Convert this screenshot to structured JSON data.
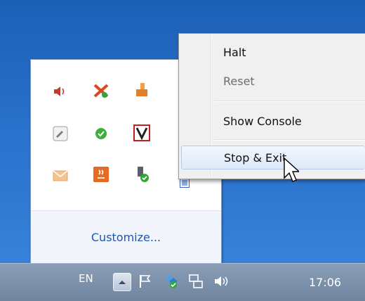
{
  "desktop": {
    "background": "#2a72cc"
  },
  "flyout": {
    "icons": [
      {
        "name": "volume-red-icon",
        "glyph": "🔈",
        "color": "#c03a2a"
      },
      {
        "name": "utility-x-icon",
        "glyph": "✖",
        "color": "#d84a1c"
      },
      {
        "name": "bucket-tool-icon",
        "glyph": "⛽",
        "color": "#e0802a"
      },
      {
        "name": "wrench-box-icon",
        "glyph": "🔧",
        "color": "#808890"
      },
      {
        "name": "green-chat-icon",
        "glyph": "●",
        "color": "#3fae3a"
      },
      {
        "name": "v-check-icon",
        "glyph": "V",
        "color": "#c02020"
      },
      {
        "name": "envelope-icon",
        "glyph": "✉",
        "color": "#e8b27a"
      },
      {
        "name": "java-icon",
        "glyph": "♨",
        "color": "#e06a1e"
      },
      {
        "name": "usb-safe-remove-icon",
        "glyph": "⏚",
        "color": "#5a6068"
      },
      {
        "name": "partial-blue-icon",
        "glyph": "▣",
        "color": "#3a62c8"
      }
    ],
    "customize_label": "Customize..."
  },
  "context_menu": {
    "items": [
      {
        "label": "Halt",
        "state": "enabled"
      },
      {
        "label": "Reset",
        "state": "disabled"
      },
      {
        "label": "Show Console",
        "state": "enabled"
      },
      {
        "label": "Stop & Exit",
        "state": "hover"
      }
    ]
  },
  "taskbar": {
    "language": "EN",
    "show_hidden_icon": "chevron-up-icon",
    "tray_icons": [
      "flag-icon",
      "network-sync-icon",
      "network-icon",
      "speaker-icon"
    ],
    "clock": "17:06"
  }
}
